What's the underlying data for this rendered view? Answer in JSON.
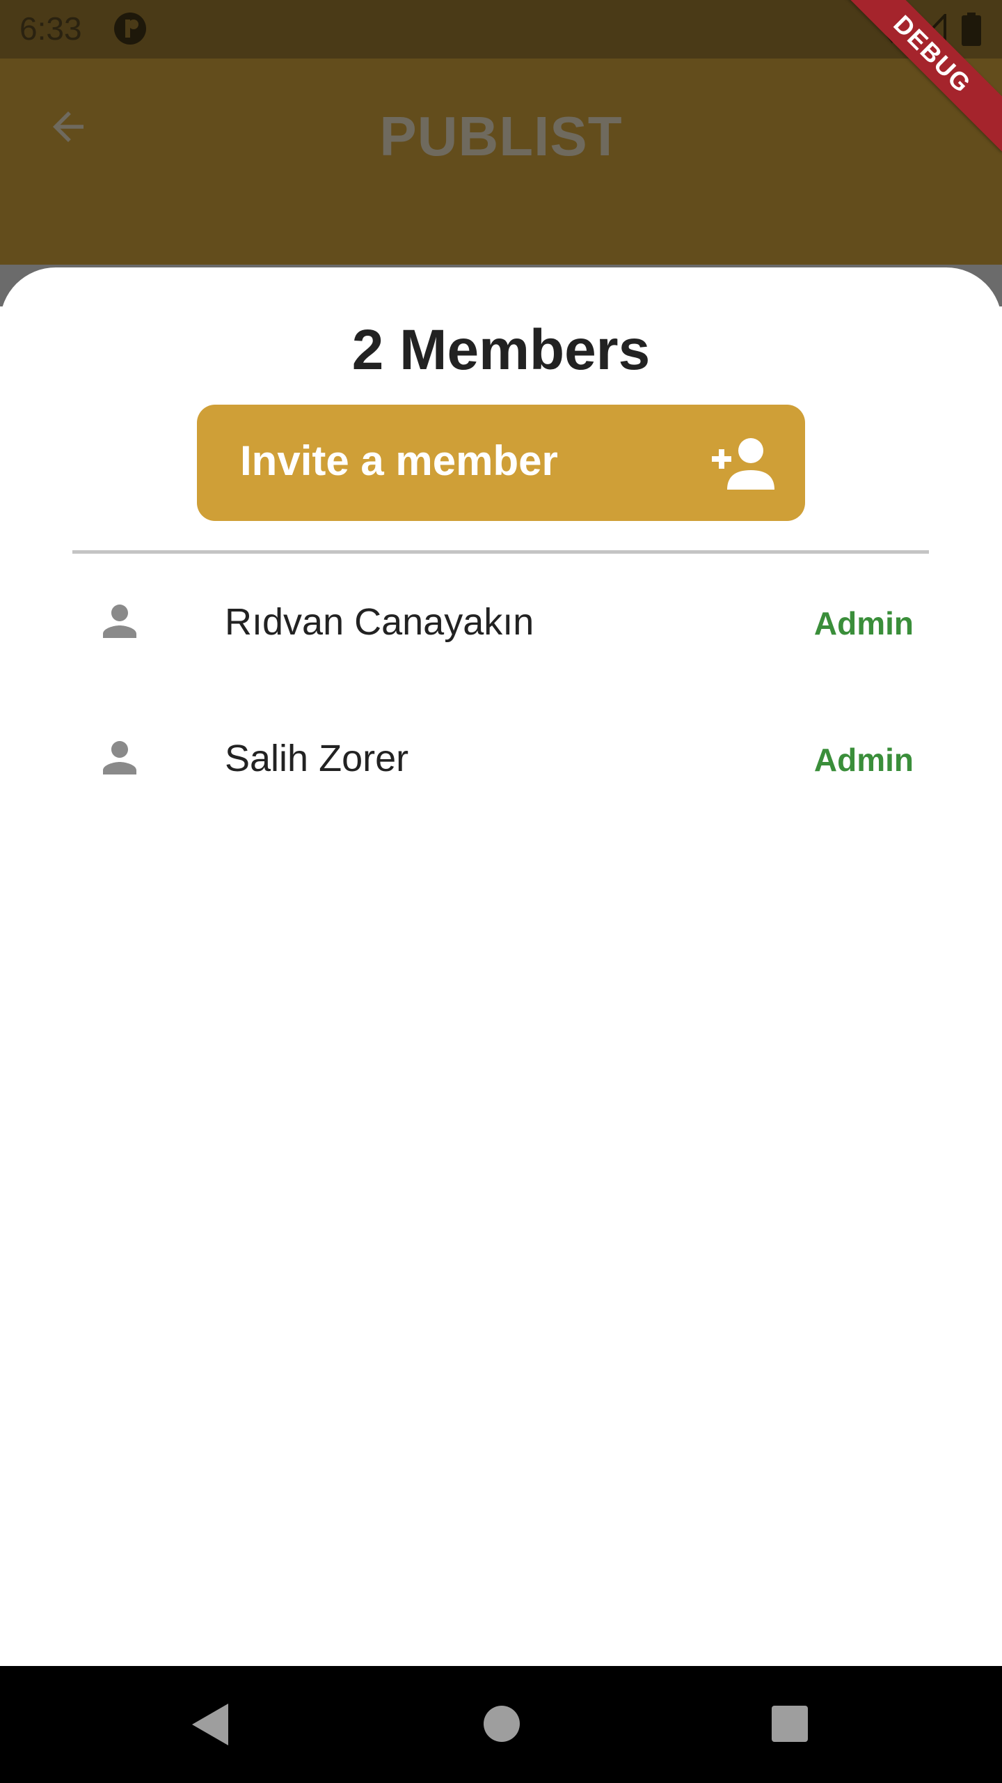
{
  "status_bar": {
    "time": "6:33",
    "icons": [
      "app-notification-icon",
      "wifi-icon",
      "signal-icon",
      "battery-icon"
    ]
  },
  "app_bar": {
    "title": "PUBLIST",
    "back_icon": "arrow-back-icon"
  },
  "debug_banner": "DEBUG",
  "sheet": {
    "title": "2 Members",
    "invite_button": {
      "label": "Invite a member",
      "icon": "person-add-icon"
    },
    "members": [
      {
        "name": "Rıdvan Canayakın",
        "role": "Admin",
        "icon": "person-icon"
      },
      {
        "name": "Salih Zorer",
        "role": "Admin",
        "icon": "person-icon"
      }
    ]
  },
  "nav_bar": {
    "icons": [
      "nav-back-icon",
      "nav-home-icon",
      "nav-recents-icon"
    ]
  },
  "colors": {
    "app_bar": "#634d1c",
    "accent": "#cf9f37",
    "role_green": "#3a8e3a",
    "debug_red": "#a5242c"
  }
}
